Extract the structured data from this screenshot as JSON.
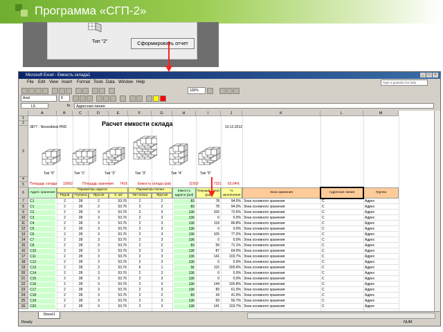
{
  "slide": {
    "title": "Программа «СГП-2»"
  },
  "dialog": {
    "type_label": "Тип \"2\"",
    "report_button": "Сформировать отчет"
  },
  "excel": {
    "window_title": "Microsoft Excel - Емкость склада1",
    "menu": [
      "File",
      "Edit",
      "View",
      "Insert",
      "Format",
      "Tools",
      "Data",
      "Window",
      "Help"
    ],
    "help_placeholder": "Type a question for help",
    "zoom": "100%",
    "font": "Arial",
    "font_size": "8",
    "name_box": "L5",
    "fx": "fx",
    "formula": "Адресная линия",
    "columns": [
      "A",
      "B",
      "C",
      "D",
      "E",
      "F",
      "G",
      "H",
      "I",
      "J",
      "K",
      "L",
      "M"
    ],
    "rows_top": [
      "1",
      "2",
      "3",
      "4",
      "5",
      "6"
    ],
    "heading": "Расчет емкости склада",
    "subtitle_left": "3877 - Novosibirsk PRD",
    "date": "10.12.2012",
    "block_types": [
      "Тип \"0\"",
      "Тип \"1\"",
      "Тип \"2\"",
      "Тип \"3\"",
      "Тип \"4\"",
      "Тип \"5\""
    ],
    "summary": {
      "area_label": "Площадь склада",
      "area_value": "10062",
      "storage_area_label": "Площадь хранения",
      "storage_area_value": "7416",
      "capacity_label": "Емкость склада (pal)",
      "capacity_value": "11503",
      "stock_value": "7321",
      "percent_value": "63.64%"
    },
    "headers": {
      "address": "Адрес хранения",
      "address_params": "Параметры адреса",
      "block_params": "Параметры блока",
      "capacity": "Емкость адреса (pal)",
      "current_stock": "Текущий запас (pal)",
      "fill_pct": "% заполнения",
      "zone": "Зона хранения",
      "line": "Адресная линия",
      "group": "Группа",
      "rows": "Рядов",
      "depth": "Глубина",
      "tiers": "Ярусов",
      "area": "S, м2",
      "block_type": "Тип блока",
      "block_tiers": "Ярусов"
    },
    "data_rows": [
      {
        "n": "7",
        "a": "C1",
        "b": "2",
        "c": "28",
        "d": "2",
        "e": "53.76",
        "f": "2",
        "g": "2",
        "h": "83",
        "i": "78",
        "j": "94.0%",
        "k": "Зона основного хранения",
        "l": "C",
        "m": "Адрес"
      },
      {
        "n": "8",
        "a": "C1",
        "b": "2",
        "c": "28",
        "d": "2",
        "e": "53.76",
        "f": "2",
        "g": "2",
        "h": "83",
        "i": "78",
        "j": "94.0%",
        "k": "Зона основного хранения",
        "l": "C",
        "m": "Адрес"
      },
      {
        "n": "9",
        "a": "C2",
        "b": "2",
        "c": "28",
        "d": "3",
        "e": "53.76",
        "f": "2",
        "g": "3",
        "h": "136",
        "i": "100",
        "j": "73.5%",
        "k": "Зона основного хранения",
        "l": "C",
        "m": "Адрес"
      },
      {
        "n": "10",
        "a": "C3",
        "b": "2",
        "c": "28",
        "d": "3",
        "e": "53.76",
        "f": "2",
        "g": "3",
        "h": "136",
        "i": "0",
        "j": "0.0%",
        "k": "Зона основного хранения",
        "l": "C",
        "m": "Адрес"
      },
      {
        "n": "11",
        "a": "C4",
        "b": "2",
        "c": "28",
        "d": "3",
        "e": "53.76",
        "f": "2",
        "g": "3",
        "h": "136",
        "i": "118",
        "j": "86.8%",
        "k": "Зона основного хранения",
        "l": "C",
        "m": "Адрес"
      },
      {
        "n": "12",
        "a": "C5",
        "b": "2",
        "c": "28",
        "d": "3",
        "e": "53.76",
        "f": "2",
        "g": "3",
        "h": "136",
        "i": "0",
        "j": "0.0%",
        "k": "Зона основного хранения",
        "l": "C",
        "m": "Адрес"
      },
      {
        "n": "13",
        "a": "C6",
        "b": "2",
        "c": "28",
        "d": "3",
        "e": "53.76",
        "f": "2",
        "g": "3",
        "h": "136",
        "i": "105",
        "j": "77.2%",
        "k": "Зона основного хранения",
        "l": "C",
        "m": "Адрес"
      },
      {
        "n": "14",
        "a": "C7",
        "b": "2",
        "c": "28",
        "d": "3",
        "e": "53.76",
        "f": "2",
        "g": "3",
        "h": "136",
        "i": "0",
        "j": "0.0%",
        "k": "Зона основного хранения",
        "l": "C",
        "m": "Адрес"
      },
      {
        "n": "15",
        "a": "C8",
        "b": "2",
        "c": "28",
        "d": "3",
        "e": "53.76",
        "f": "2",
        "g": "2",
        "h": "83",
        "i": "59",
        "j": "71.1%",
        "k": "Зона основного хранения",
        "l": "C",
        "m": "Адрес"
      },
      {
        "n": "16",
        "a": "C10",
        "b": "2",
        "c": "28",
        "d": "3",
        "e": "53.76",
        "f": "2",
        "g": "3",
        "h": "136",
        "i": "87",
        "j": "64.0%",
        "k": "Зона основного хранения",
        "l": "C",
        "m": "Адрес"
      },
      {
        "n": "17",
        "a": "C11",
        "b": "2",
        "c": "28",
        "d": "3",
        "e": "53.76",
        "f": "2",
        "g": "3",
        "h": "136",
        "i": "141",
        "j": "103.7%",
        "k": "Зона основного хранения",
        "l": "C",
        "m": "Адрес"
      },
      {
        "n": "18",
        "a": "C12",
        "b": "2",
        "c": "28",
        "d": "3",
        "e": "53.76",
        "f": "2",
        "g": "3",
        "h": "136",
        "i": "0",
        "j": "0.0%",
        "k": "Зона основного хранения",
        "l": "C",
        "m": "Адрес"
      },
      {
        "n": "19",
        "a": "C13",
        "b": "2",
        "c": "28",
        "d": "3",
        "e": "53.76",
        "f": "6",
        "g": "1",
        "h": "56",
        "i": "115",
        "j": "205.4%",
        "k": "Зона основного хранения",
        "l": "C",
        "m": "Адрес"
      },
      {
        "n": "20",
        "a": "C14",
        "b": "2",
        "c": "28",
        "d": "3",
        "e": "53.76",
        "f": "2",
        "g": "3",
        "h": "136",
        "i": "0",
        "j": "0.0%",
        "k": "Зона основного хранения",
        "l": "C",
        "m": "Адрес"
      },
      {
        "n": "21",
        "a": "C15",
        "b": "2",
        "c": "28",
        "d": "3",
        "e": "53.76",
        "f": "2",
        "g": "3",
        "h": "136",
        "i": "0",
        "j": "0.0%",
        "k": "Зона основного хранения",
        "l": "C",
        "m": "Адрес"
      },
      {
        "n": "22",
        "a": "C16",
        "b": "2",
        "c": "28",
        "d": "3",
        "e": "53.76",
        "f": "2",
        "g": "3",
        "h": "136",
        "i": "144",
        "j": "105.8%",
        "k": "Зона основного хранения",
        "l": "C",
        "m": "Адрес"
      },
      {
        "n": "23",
        "a": "C17",
        "b": "2",
        "c": "28",
        "d": "3",
        "e": "53.76",
        "f": "2",
        "g": "3",
        "h": "136",
        "i": "83",
        "j": "61.0%",
        "k": "Зона основного хранения",
        "l": "C",
        "m": "Адрес"
      },
      {
        "n": "24",
        "a": "C18",
        "b": "2",
        "c": "28",
        "d": "3",
        "e": "53.76",
        "f": "2",
        "g": "2",
        "h": "83",
        "i": "34",
        "j": "41.0%",
        "k": "Зона основного хранения",
        "l": "C",
        "m": "Адрес"
      },
      {
        "n": "25",
        "a": "C19",
        "b": "2",
        "c": "28",
        "d": "3",
        "e": "53.76",
        "f": "2",
        "g": "3",
        "h": "136",
        "i": "69",
        "j": "50.7%",
        "k": "Зона основного хранения",
        "l": "C",
        "m": "Адрес"
      },
      {
        "n": "26",
        "a": "C20",
        "b": "2",
        "c": "28",
        "d": "3",
        "e": "53.76",
        "f": "2",
        "g": "3",
        "h": "136",
        "i": "141",
        "j": "103.7%",
        "k": "Зона основного хранения",
        "l": "C",
        "m": "Адрес"
      }
    ],
    "sheet_tab": "Sheet1",
    "status_left": "Ready",
    "status_right": "NUM"
  },
  "colors": {
    "green": "#ccffcc",
    "orange": "#ffcc99",
    "yellow": "#ffff99",
    "selection": "#000000",
    "arrow": "#ff2020"
  }
}
